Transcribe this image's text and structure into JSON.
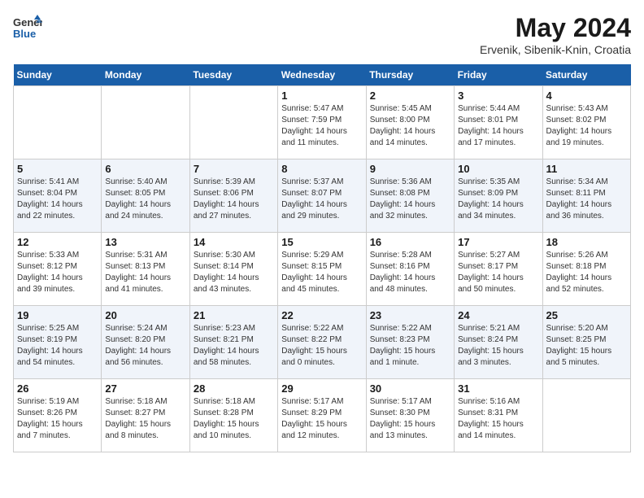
{
  "header": {
    "logo_general": "General",
    "logo_blue": "Blue",
    "title": "May 2024",
    "subtitle": "Ervenik, Sibenik-Knin, Croatia"
  },
  "days": [
    "Sunday",
    "Monday",
    "Tuesday",
    "Wednesday",
    "Thursday",
    "Friday",
    "Saturday"
  ],
  "weeks": [
    [
      {
        "date": "",
        "sunrise": "",
        "sunset": "",
        "daylight": ""
      },
      {
        "date": "",
        "sunrise": "",
        "sunset": "",
        "daylight": ""
      },
      {
        "date": "",
        "sunrise": "",
        "sunset": "",
        "daylight": ""
      },
      {
        "date": "1",
        "sunrise": "Sunrise: 5:47 AM",
        "sunset": "Sunset: 7:59 PM",
        "daylight": "Daylight: 14 hours and 11 minutes."
      },
      {
        "date": "2",
        "sunrise": "Sunrise: 5:45 AM",
        "sunset": "Sunset: 8:00 PM",
        "daylight": "Daylight: 14 hours and 14 minutes."
      },
      {
        "date": "3",
        "sunrise": "Sunrise: 5:44 AM",
        "sunset": "Sunset: 8:01 PM",
        "daylight": "Daylight: 14 hours and 17 minutes."
      },
      {
        "date": "4",
        "sunrise": "Sunrise: 5:43 AM",
        "sunset": "Sunset: 8:02 PM",
        "daylight": "Daylight: 14 hours and 19 minutes."
      }
    ],
    [
      {
        "date": "5",
        "sunrise": "Sunrise: 5:41 AM",
        "sunset": "Sunset: 8:04 PM",
        "daylight": "Daylight: 14 hours and 22 minutes."
      },
      {
        "date": "6",
        "sunrise": "Sunrise: 5:40 AM",
        "sunset": "Sunset: 8:05 PM",
        "daylight": "Daylight: 14 hours and 24 minutes."
      },
      {
        "date": "7",
        "sunrise": "Sunrise: 5:39 AM",
        "sunset": "Sunset: 8:06 PM",
        "daylight": "Daylight: 14 hours and 27 minutes."
      },
      {
        "date": "8",
        "sunrise": "Sunrise: 5:37 AM",
        "sunset": "Sunset: 8:07 PM",
        "daylight": "Daylight: 14 hours and 29 minutes."
      },
      {
        "date": "9",
        "sunrise": "Sunrise: 5:36 AM",
        "sunset": "Sunset: 8:08 PM",
        "daylight": "Daylight: 14 hours and 32 minutes."
      },
      {
        "date": "10",
        "sunrise": "Sunrise: 5:35 AM",
        "sunset": "Sunset: 8:09 PM",
        "daylight": "Daylight: 14 hours and 34 minutes."
      },
      {
        "date": "11",
        "sunrise": "Sunrise: 5:34 AM",
        "sunset": "Sunset: 8:11 PM",
        "daylight": "Daylight: 14 hours and 36 minutes."
      }
    ],
    [
      {
        "date": "12",
        "sunrise": "Sunrise: 5:33 AM",
        "sunset": "Sunset: 8:12 PM",
        "daylight": "Daylight: 14 hours and 39 minutes."
      },
      {
        "date": "13",
        "sunrise": "Sunrise: 5:31 AM",
        "sunset": "Sunset: 8:13 PM",
        "daylight": "Daylight: 14 hours and 41 minutes."
      },
      {
        "date": "14",
        "sunrise": "Sunrise: 5:30 AM",
        "sunset": "Sunset: 8:14 PM",
        "daylight": "Daylight: 14 hours and 43 minutes."
      },
      {
        "date": "15",
        "sunrise": "Sunrise: 5:29 AM",
        "sunset": "Sunset: 8:15 PM",
        "daylight": "Daylight: 14 hours and 45 minutes."
      },
      {
        "date": "16",
        "sunrise": "Sunrise: 5:28 AM",
        "sunset": "Sunset: 8:16 PM",
        "daylight": "Daylight: 14 hours and 48 minutes."
      },
      {
        "date": "17",
        "sunrise": "Sunrise: 5:27 AM",
        "sunset": "Sunset: 8:17 PM",
        "daylight": "Daylight: 14 hours and 50 minutes."
      },
      {
        "date": "18",
        "sunrise": "Sunrise: 5:26 AM",
        "sunset": "Sunset: 8:18 PM",
        "daylight": "Daylight: 14 hours and 52 minutes."
      }
    ],
    [
      {
        "date": "19",
        "sunrise": "Sunrise: 5:25 AM",
        "sunset": "Sunset: 8:19 PM",
        "daylight": "Daylight: 14 hours and 54 minutes."
      },
      {
        "date": "20",
        "sunrise": "Sunrise: 5:24 AM",
        "sunset": "Sunset: 8:20 PM",
        "daylight": "Daylight: 14 hours and 56 minutes."
      },
      {
        "date": "21",
        "sunrise": "Sunrise: 5:23 AM",
        "sunset": "Sunset: 8:21 PM",
        "daylight": "Daylight: 14 hours and 58 minutes."
      },
      {
        "date": "22",
        "sunrise": "Sunrise: 5:22 AM",
        "sunset": "Sunset: 8:22 PM",
        "daylight": "Daylight: 15 hours and 0 minutes."
      },
      {
        "date": "23",
        "sunrise": "Sunrise: 5:22 AM",
        "sunset": "Sunset: 8:23 PM",
        "daylight": "Daylight: 15 hours and 1 minute."
      },
      {
        "date": "24",
        "sunrise": "Sunrise: 5:21 AM",
        "sunset": "Sunset: 8:24 PM",
        "daylight": "Daylight: 15 hours and 3 minutes."
      },
      {
        "date": "25",
        "sunrise": "Sunrise: 5:20 AM",
        "sunset": "Sunset: 8:25 PM",
        "daylight": "Daylight: 15 hours and 5 minutes."
      }
    ],
    [
      {
        "date": "26",
        "sunrise": "Sunrise: 5:19 AM",
        "sunset": "Sunset: 8:26 PM",
        "daylight": "Daylight: 15 hours and 7 minutes."
      },
      {
        "date": "27",
        "sunrise": "Sunrise: 5:18 AM",
        "sunset": "Sunset: 8:27 PM",
        "daylight": "Daylight: 15 hours and 8 minutes."
      },
      {
        "date": "28",
        "sunrise": "Sunrise: 5:18 AM",
        "sunset": "Sunset: 8:28 PM",
        "daylight": "Daylight: 15 hours and 10 minutes."
      },
      {
        "date": "29",
        "sunrise": "Sunrise: 5:17 AM",
        "sunset": "Sunset: 8:29 PM",
        "daylight": "Daylight: 15 hours and 12 minutes."
      },
      {
        "date": "30",
        "sunrise": "Sunrise: 5:17 AM",
        "sunset": "Sunset: 8:30 PM",
        "daylight": "Daylight: 15 hours and 13 minutes."
      },
      {
        "date": "31",
        "sunrise": "Sunrise: 5:16 AM",
        "sunset": "Sunset: 8:31 PM",
        "daylight": "Daylight: 15 hours and 14 minutes."
      },
      {
        "date": "",
        "sunrise": "",
        "sunset": "",
        "daylight": ""
      }
    ]
  ]
}
